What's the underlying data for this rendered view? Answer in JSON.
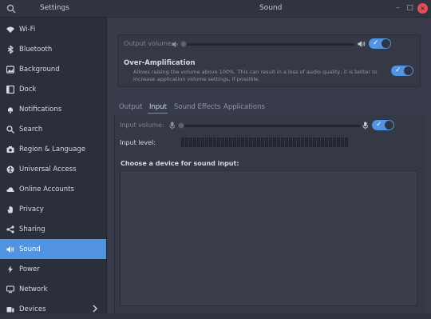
{
  "window": {
    "left_title": "Settings",
    "title": "Sound",
    "minimize": "–",
    "maximize": "□",
    "close": "×"
  },
  "sidebar": {
    "items": [
      {
        "label": "Wi-Fi",
        "icon": "wifi-icon"
      },
      {
        "label": "Bluetooth",
        "icon": "bluetooth-icon"
      },
      {
        "label": "Background",
        "icon": "background-icon"
      },
      {
        "label": "Dock",
        "icon": "dock-icon"
      },
      {
        "label": "Notifications",
        "icon": "bell-icon"
      },
      {
        "label": "Search",
        "icon": "search-icon"
      },
      {
        "label": "Region & Language",
        "icon": "camera-icon"
      },
      {
        "label": "Universal Access",
        "icon": "accessibility-icon"
      },
      {
        "label": "Online Accounts",
        "icon": "cloud-icon"
      },
      {
        "label": "Privacy",
        "icon": "hand-icon"
      },
      {
        "label": "Sharing",
        "icon": "share-icon"
      },
      {
        "label": "Sound",
        "icon": "speaker-icon",
        "active": true
      },
      {
        "label": "Power",
        "icon": "power-icon"
      },
      {
        "label": "Network",
        "icon": "network-icon"
      },
      {
        "label": "Devices",
        "icon": "devices-icon"
      }
    ]
  },
  "output": {
    "volume_label": "Output volume:",
    "volume_level": 0.0,
    "muted": false
  },
  "over_amplification": {
    "title": "Over-Amplification",
    "description_line1": "Allows raising the volume above 100%. This can result in a loss of audio quality; it is better to",
    "description_line2": "increase application volume settings, if possible.",
    "enabled": true
  },
  "tabs": [
    {
      "label": "Output"
    },
    {
      "label": "Input",
      "active": true
    },
    {
      "label": "Sound Effects"
    },
    {
      "label": "Applications"
    }
  ],
  "input": {
    "volume_label": "Input volume:",
    "volume_level": 0.0,
    "level_label": "Input level:",
    "level_value": 0.0,
    "enabled": true,
    "device_heading": "Choose a device for sound input:"
  },
  "colors": {
    "accent": "#5294e2",
    "background": "#383c4a",
    "sidebar": "#2b2f39"
  }
}
